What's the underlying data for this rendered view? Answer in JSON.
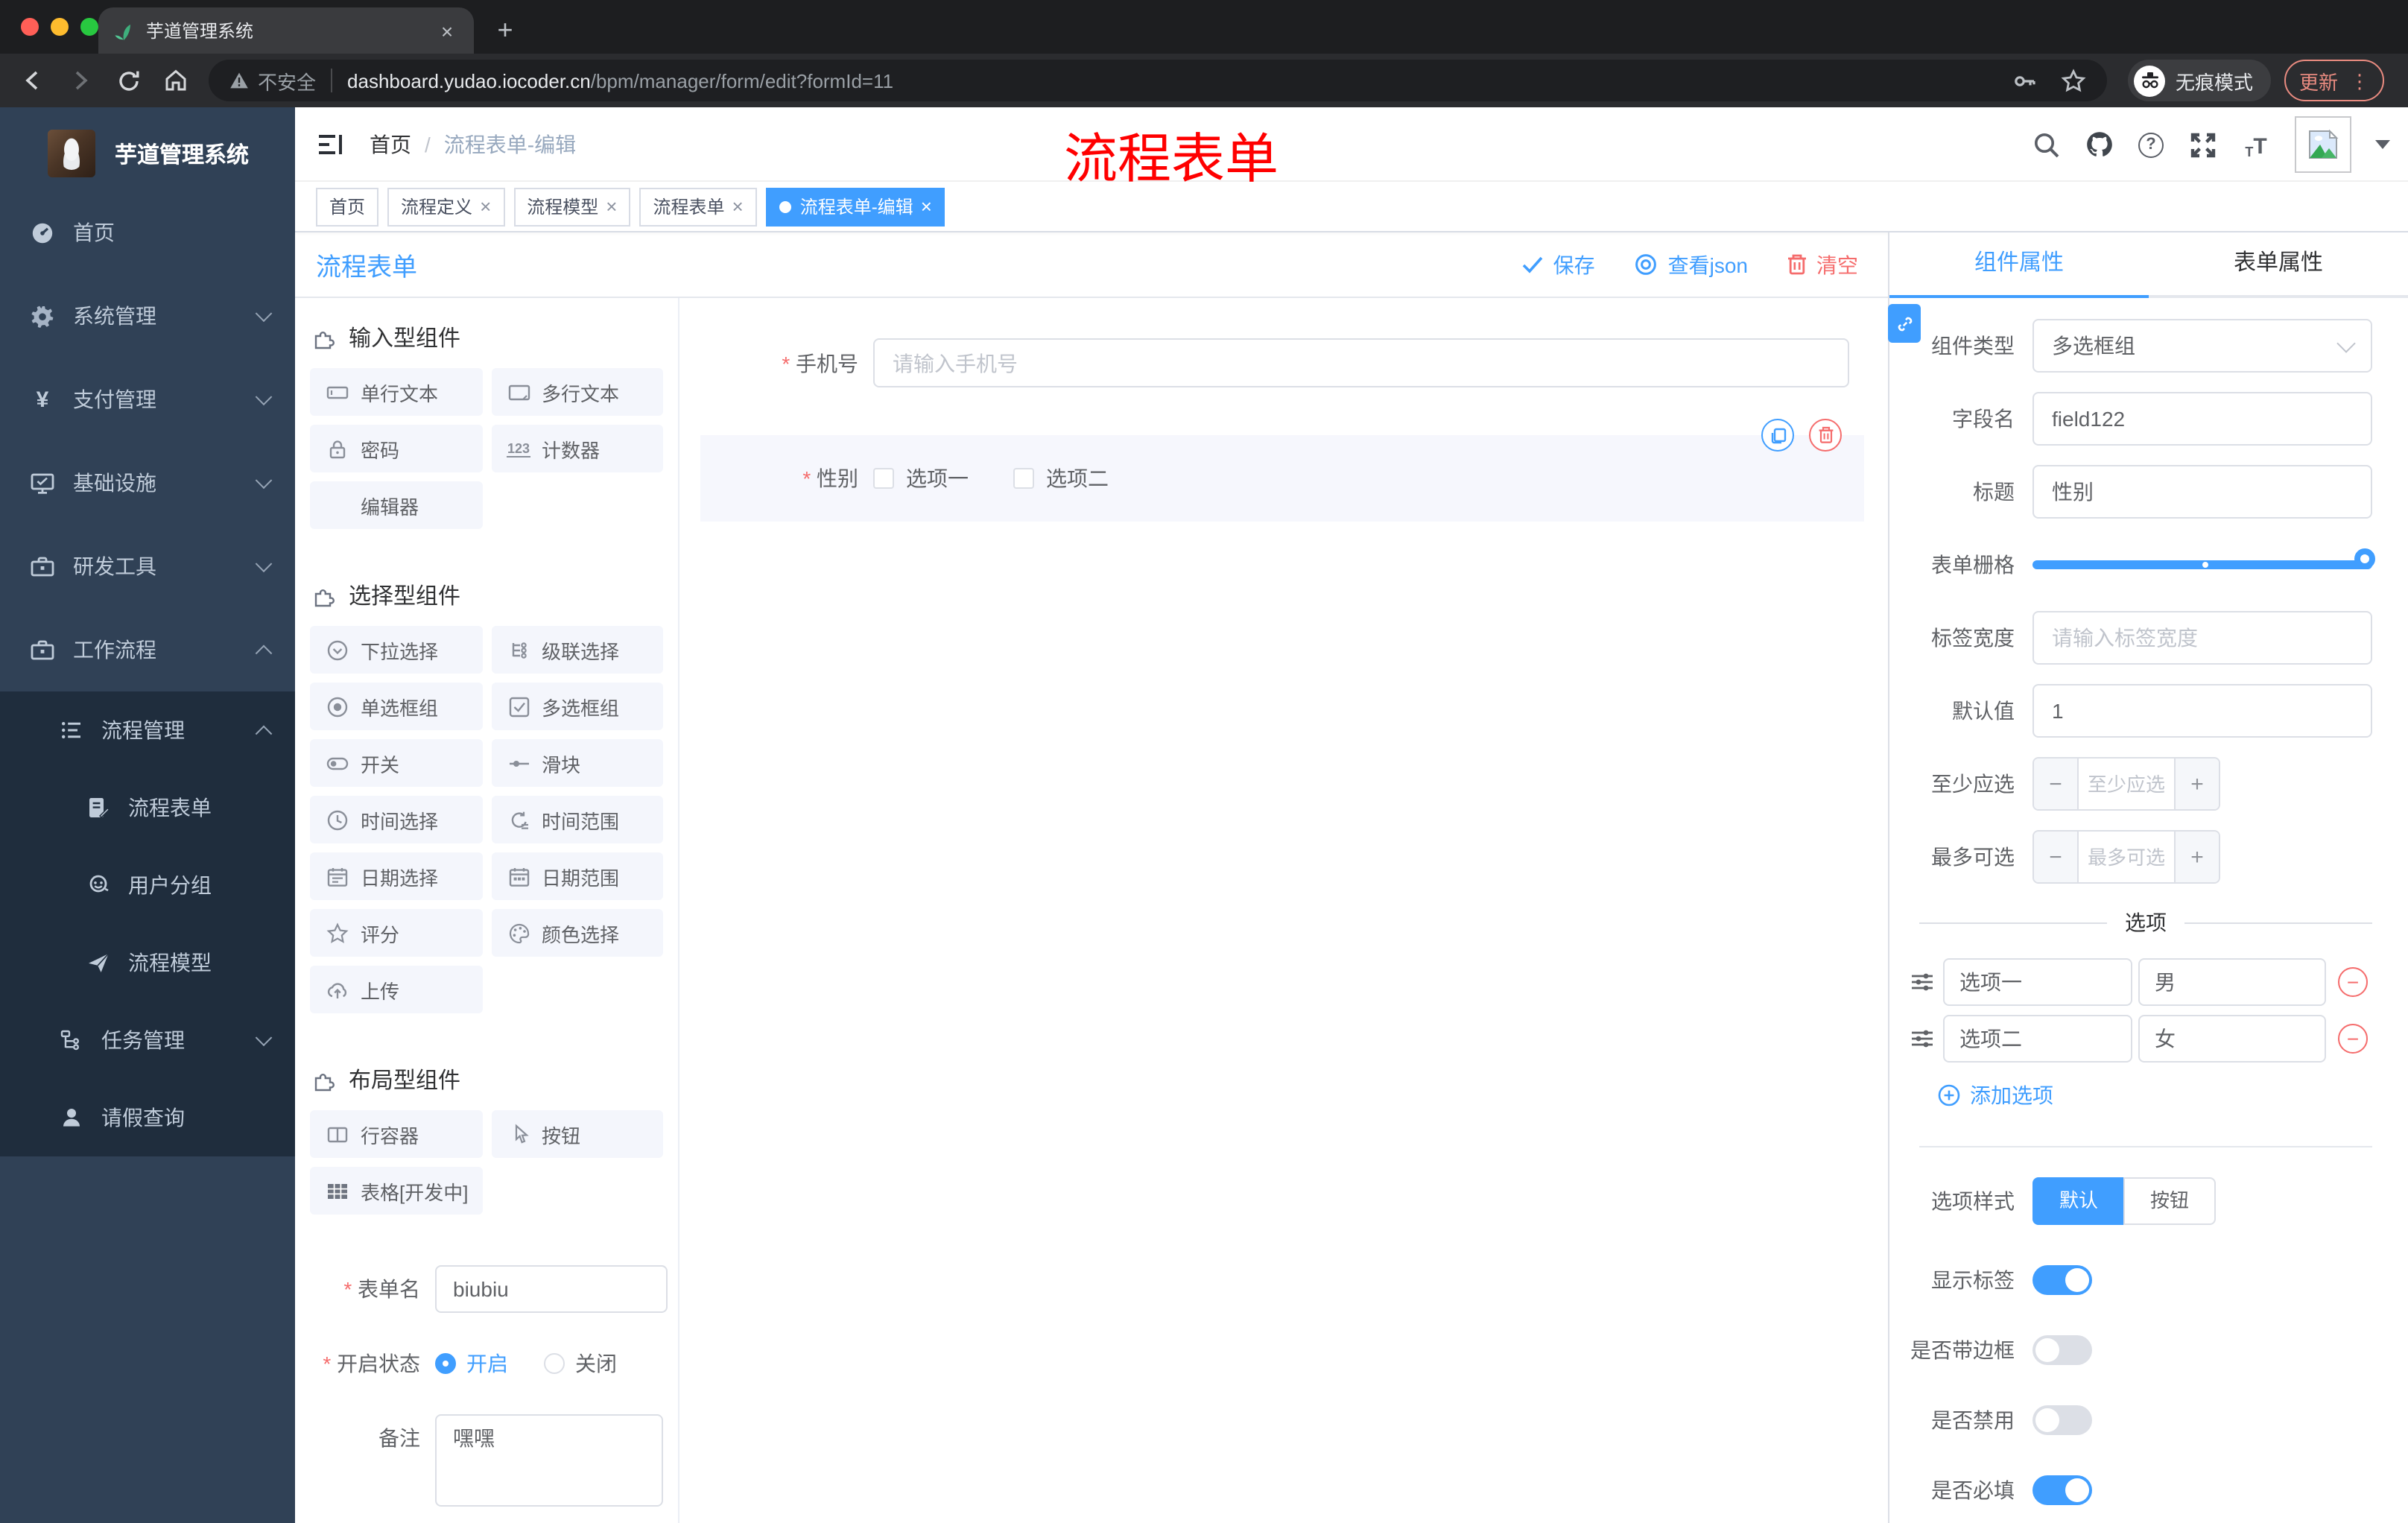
{
  "browser": {
    "tab_title": "芋道管理系统",
    "security_label": "不安全",
    "url_host": "dashboard.yudao.iocoder.cn",
    "url_path": "/bpm/manager/form/edit?formId=11",
    "incognito_label": "无痕模式",
    "update_label": "更新"
  },
  "sidebar": {
    "app_title": "芋道管理系统",
    "menu": [
      {
        "label": "首页"
      },
      {
        "label": "系统管理"
      },
      {
        "label": "支付管理"
      },
      {
        "label": "基础设施"
      },
      {
        "label": "研发工具"
      },
      {
        "label": "工作流程"
      }
    ],
    "submenu": [
      {
        "label": "流程管理"
      },
      {
        "label": "流程表单"
      },
      {
        "label": "用户分组"
      },
      {
        "label": "流程模型"
      },
      {
        "label": "任务管理"
      },
      {
        "label": "请假查询"
      }
    ]
  },
  "navbar": {
    "breadcrumb_home": "首页",
    "breadcrumb_sep": "/",
    "breadcrumb_current": "流程表单-编辑",
    "watermark": "流程表单"
  },
  "tags": [
    {
      "label": "首页"
    },
    {
      "label": "流程定义"
    },
    {
      "label": "流程模型"
    },
    {
      "label": "流程表单"
    },
    {
      "label": "流程表单-编辑"
    }
  ],
  "toolbar": {
    "title": "流程表单",
    "save": "保存",
    "view_json": "查看json",
    "clear": "清空"
  },
  "components_panel": {
    "sections": [
      {
        "title": "输入型组件",
        "items": [
          {
            "label": "单行文本"
          },
          {
            "label": "多行文本"
          },
          {
            "label": "密码"
          },
          {
            "label": "计数器"
          },
          {
            "label": "编辑器"
          }
        ]
      },
      {
        "title": "选择型组件",
        "items": [
          {
            "label": "下拉选择"
          },
          {
            "label": "级联选择"
          },
          {
            "label": "单选框组"
          },
          {
            "label": "多选框组"
          },
          {
            "label": "开关"
          },
          {
            "label": "滑块"
          },
          {
            "label": "时间选择"
          },
          {
            "label": "时间范围"
          },
          {
            "label": "日期选择"
          },
          {
            "label": "日期范围"
          },
          {
            "label": "评分"
          },
          {
            "label": "颜色选择"
          },
          {
            "label": "上传"
          }
        ]
      },
      {
        "title": "布局型组件",
        "items": [
          {
            "label": "行容器"
          },
          {
            "label": "按钮"
          },
          {
            "label": "表格[开发中]"
          }
        ]
      }
    ],
    "form": {
      "name_label": "表单名",
      "name_value": "biubiu",
      "status_label": "开启状态",
      "status_on": "开启",
      "status_off": "关闭",
      "remark_label": "备注",
      "remark_value": "嘿嘿"
    }
  },
  "canvas": {
    "phone_label": "手机号",
    "phone_placeholder": "请输入手机号",
    "gender_label": "性别",
    "gender_opt1": "选项一",
    "gender_opt2": "选项二"
  },
  "props": {
    "tab_component": "组件属性",
    "tab_form": "表单属性",
    "type_label": "组件类型",
    "type_value": "多选框组",
    "field_label": "字段名",
    "field_value": "field122",
    "title_label": "标题",
    "title_value": "性别",
    "grid_label": "表单栅格",
    "width_label": "标签宽度",
    "width_placeholder": "请输入标签宽度",
    "default_label": "默认值",
    "default_value": "1",
    "min_label": "至少应选",
    "min_placeholder": "至少应选",
    "max_label": "最多可选",
    "max_placeholder": "最多可选",
    "options_title": "选项",
    "options": [
      {
        "name": "选项一",
        "value": "男"
      },
      {
        "name": "选项二",
        "value": "女"
      }
    ],
    "add_option": "添加选项",
    "style_label": "选项样式",
    "style_default": "默认",
    "style_button": "按钮",
    "toggle_show_label": "显示标签",
    "toggle_border_label": "是否带边框",
    "toggle_disabled_label": "是否禁用",
    "toggle_required_label": "是否必填"
  },
  "colors": {
    "primary": "#409eff",
    "danger": "#f56c6c",
    "sidebar": "#304156"
  }
}
